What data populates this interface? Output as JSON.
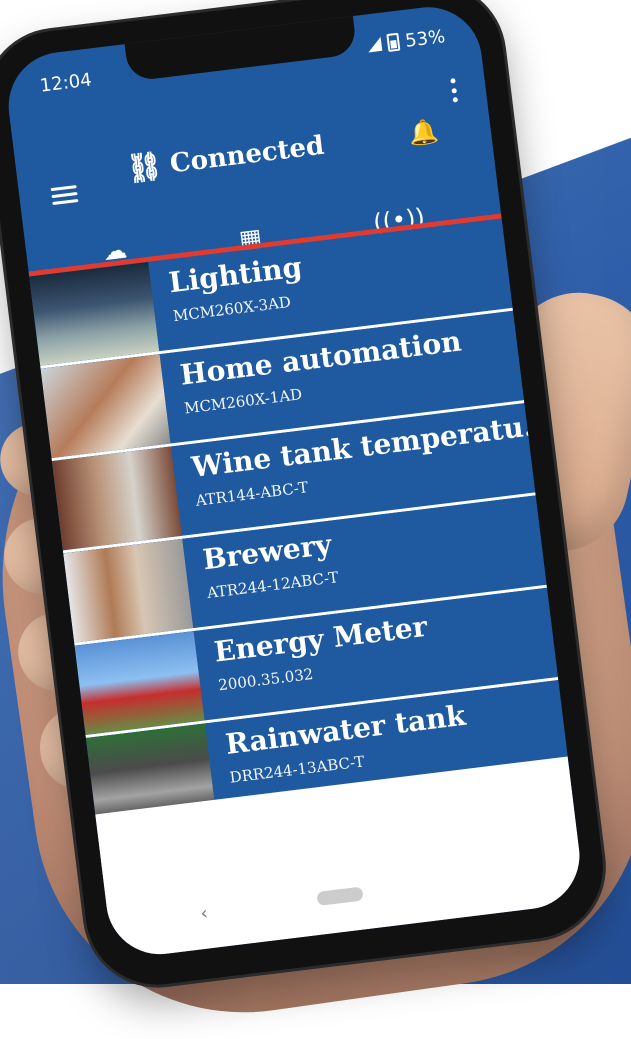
{
  "status_bar": {
    "time": "12:04",
    "battery": "53%"
  },
  "header": {
    "title": "Connected"
  },
  "tabs": {
    "active": "cloud"
  },
  "icons": {
    "menu": "menu-icon",
    "link": "link-icon",
    "bell": "bell-icon",
    "more": "kebab-icon",
    "tab_cloud": "cloud-icon",
    "tab_grid": "dashboard-icon",
    "tab_signal": "signal-icon"
  },
  "colors": {
    "primary": "#1f5aa0",
    "accent": "#e33a2f",
    "background_blue": "#2d5da8"
  },
  "devices": [
    {
      "title": "Lighting",
      "subtitle": "MCM260X-3AD",
      "image": "lighting"
    },
    {
      "title": "Home automation",
      "subtitle": "MCM260X-1AD",
      "image": "home"
    },
    {
      "title": "Wine tank temperatu...",
      "subtitle": "ATR144-ABC-T",
      "image": "wine"
    },
    {
      "title": "Brewery",
      "subtitle": "ATR244-12ABC-T",
      "image": "brewery"
    },
    {
      "title": "Energy Meter",
      "subtitle": "2000.35.032",
      "image": "energy"
    },
    {
      "title": "Rainwater tank",
      "subtitle": "DRR244-13ABC-T",
      "image": "rain"
    }
  ]
}
